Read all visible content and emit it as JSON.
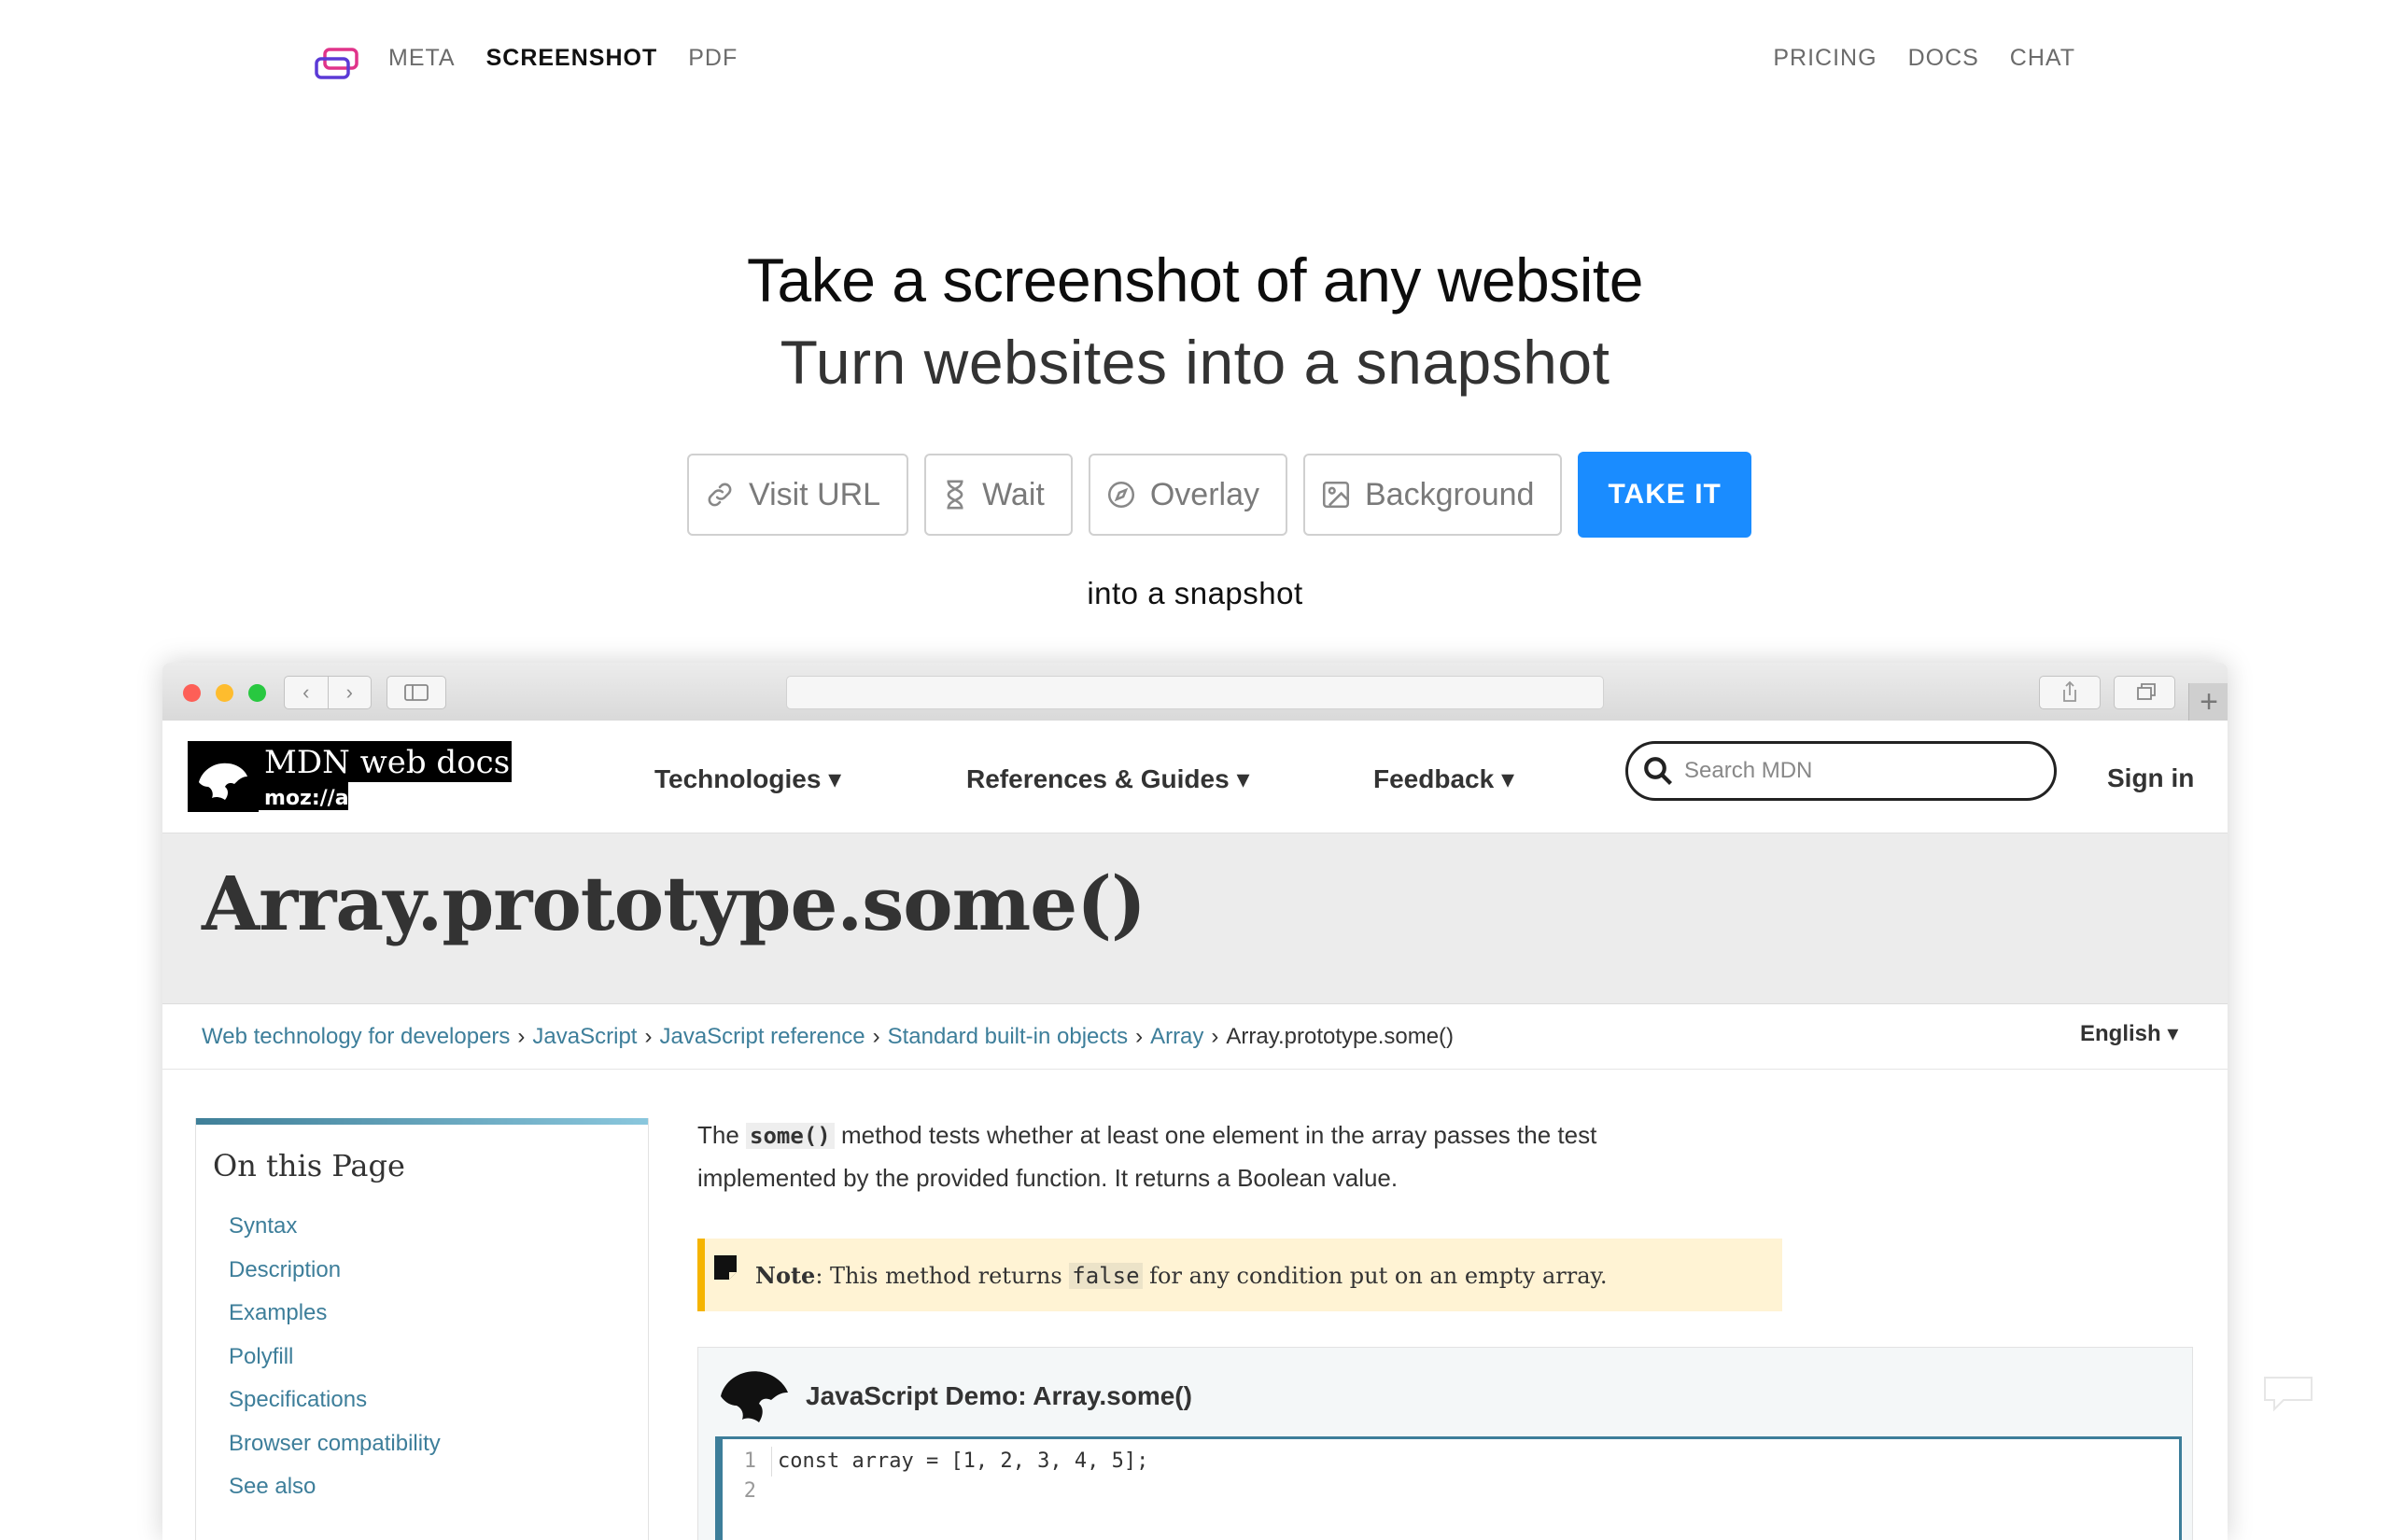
{
  "topnav": {
    "left": [
      "META",
      "SCREENSHOT",
      "PDF"
    ],
    "active": "SCREENSHOT",
    "right": [
      "PRICING",
      "DOCS",
      "CHAT"
    ]
  },
  "hero": {
    "title": "Take a screenshot of any website",
    "subtitle": "Turn websites into a snapshot",
    "options": {
      "visit_url": "Visit URL",
      "wait": "Wait",
      "overlay": "Overlay",
      "background": "Background"
    },
    "cta": "TAKE IT",
    "caption": "into a snapshot"
  },
  "browser_colors": {
    "close": "#fd5f57",
    "minimize": "#febc2e",
    "zoom": "#28c840"
  },
  "mdn": {
    "logo_text": "MDN web docs",
    "logo_sub": "moz://a",
    "menu": {
      "technologies": "Technologies ▾",
      "references": "References & Guides ▾",
      "feedback": "Feedback ▾"
    },
    "search_placeholder": "Search MDN",
    "sign_in": "Sign in",
    "page_title": "Array.prototype.some()",
    "breadcrumbs": [
      "Web technology for developers",
      "JavaScript",
      "JavaScript reference",
      "Standard built-in objects",
      "Array"
    ],
    "breadcrumb_current": "Array.prototype.some()",
    "language": "English ▾",
    "toc": {
      "heading": "On this Page",
      "items": [
        "Syntax",
        "Description",
        "Examples",
        "Polyfill",
        "Specifications",
        "Browser compatibility",
        "See also"
      ]
    },
    "intro": {
      "p1": "The ",
      "code": "some()",
      "p2": " method tests whether at least one element in the array passes the test implemented by the provided function. It returns a Boolean value."
    },
    "note": {
      "label": "Note",
      "text1": ": This method returns ",
      "code": "false",
      "text2": " for any condition put on an empty array."
    },
    "demo": {
      "title": "JavaScript Demo: Array.some()",
      "line_numbers": [
        "1",
        "2"
      ],
      "code_line": "const array = [1, 2, 3, 4, 5];"
    }
  }
}
